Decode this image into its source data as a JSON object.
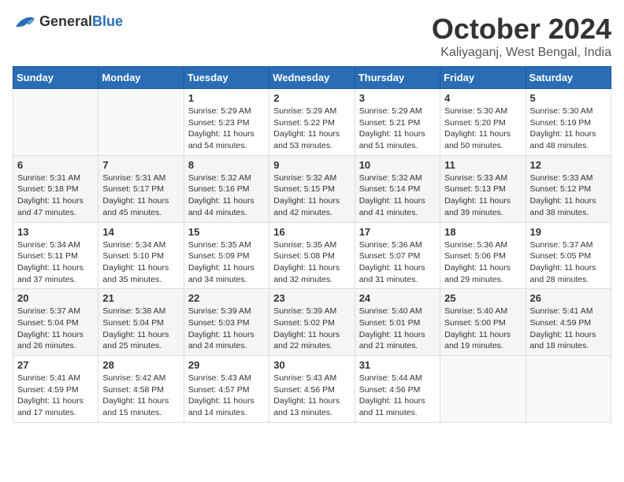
{
  "logo": {
    "general": "General",
    "blue": "Blue"
  },
  "title": "October 2024",
  "location": "Kaliyaganj, West Bengal, India",
  "weekdays": [
    "Sunday",
    "Monday",
    "Tuesday",
    "Wednesday",
    "Thursday",
    "Friday",
    "Saturday"
  ],
  "weeks": [
    [
      {
        "day": "",
        "text": ""
      },
      {
        "day": "",
        "text": ""
      },
      {
        "day": "1",
        "text": "Sunrise: 5:29 AM\nSunset: 5:23 PM\nDaylight: 11 hours and 54 minutes."
      },
      {
        "day": "2",
        "text": "Sunrise: 5:29 AM\nSunset: 5:22 PM\nDaylight: 11 hours and 53 minutes."
      },
      {
        "day": "3",
        "text": "Sunrise: 5:29 AM\nSunset: 5:21 PM\nDaylight: 11 hours and 51 minutes."
      },
      {
        "day": "4",
        "text": "Sunrise: 5:30 AM\nSunset: 5:20 PM\nDaylight: 11 hours and 50 minutes."
      },
      {
        "day": "5",
        "text": "Sunrise: 5:30 AM\nSunset: 5:19 PM\nDaylight: 11 hours and 48 minutes."
      }
    ],
    [
      {
        "day": "6",
        "text": "Sunrise: 5:31 AM\nSunset: 5:18 PM\nDaylight: 11 hours and 47 minutes."
      },
      {
        "day": "7",
        "text": "Sunrise: 5:31 AM\nSunset: 5:17 PM\nDaylight: 11 hours and 45 minutes."
      },
      {
        "day": "8",
        "text": "Sunrise: 5:32 AM\nSunset: 5:16 PM\nDaylight: 11 hours and 44 minutes."
      },
      {
        "day": "9",
        "text": "Sunrise: 5:32 AM\nSunset: 5:15 PM\nDaylight: 11 hours and 42 minutes."
      },
      {
        "day": "10",
        "text": "Sunrise: 5:32 AM\nSunset: 5:14 PM\nDaylight: 11 hours and 41 minutes."
      },
      {
        "day": "11",
        "text": "Sunrise: 5:33 AM\nSunset: 5:13 PM\nDaylight: 11 hours and 39 minutes."
      },
      {
        "day": "12",
        "text": "Sunrise: 5:33 AM\nSunset: 5:12 PM\nDaylight: 11 hours and 38 minutes."
      }
    ],
    [
      {
        "day": "13",
        "text": "Sunrise: 5:34 AM\nSunset: 5:11 PM\nDaylight: 11 hours and 37 minutes."
      },
      {
        "day": "14",
        "text": "Sunrise: 5:34 AM\nSunset: 5:10 PM\nDaylight: 11 hours and 35 minutes."
      },
      {
        "day": "15",
        "text": "Sunrise: 5:35 AM\nSunset: 5:09 PM\nDaylight: 11 hours and 34 minutes."
      },
      {
        "day": "16",
        "text": "Sunrise: 5:35 AM\nSunset: 5:08 PM\nDaylight: 11 hours and 32 minutes."
      },
      {
        "day": "17",
        "text": "Sunrise: 5:36 AM\nSunset: 5:07 PM\nDaylight: 11 hours and 31 minutes."
      },
      {
        "day": "18",
        "text": "Sunrise: 5:36 AM\nSunset: 5:06 PM\nDaylight: 11 hours and 29 minutes."
      },
      {
        "day": "19",
        "text": "Sunrise: 5:37 AM\nSunset: 5:05 PM\nDaylight: 11 hours and 28 minutes."
      }
    ],
    [
      {
        "day": "20",
        "text": "Sunrise: 5:37 AM\nSunset: 5:04 PM\nDaylight: 11 hours and 26 minutes."
      },
      {
        "day": "21",
        "text": "Sunrise: 5:38 AM\nSunset: 5:04 PM\nDaylight: 11 hours and 25 minutes."
      },
      {
        "day": "22",
        "text": "Sunrise: 5:39 AM\nSunset: 5:03 PM\nDaylight: 11 hours and 24 minutes."
      },
      {
        "day": "23",
        "text": "Sunrise: 5:39 AM\nSunset: 5:02 PM\nDaylight: 11 hours and 22 minutes."
      },
      {
        "day": "24",
        "text": "Sunrise: 5:40 AM\nSunset: 5:01 PM\nDaylight: 11 hours and 21 minutes."
      },
      {
        "day": "25",
        "text": "Sunrise: 5:40 AM\nSunset: 5:00 PM\nDaylight: 11 hours and 19 minutes."
      },
      {
        "day": "26",
        "text": "Sunrise: 5:41 AM\nSunset: 4:59 PM\nDaylight: 11 hours and 18 minutes."
      }
    ],
    [
      {
        "day": "27",
        "text": "Sunrise: 5:41 AM\nSunset: 4:59 PM\nDaylight: 11 hours and 17 minutes."
      },
      {
        "day": "28",
        "text": "Sunrise: 5:42 AM\nSunset: 4:58 PM\nDaylight: 11 hours and 15 minutes."
      },
      {
        "day": "29",
        "text": "Sunrise: 5:43 AM\nSunset: 4:57 PM\nDaylight: 11 hours and 14 minutes."
      },
      {
        "day": "30",
        "text": "Sunrise: 5:43 AM\nSunset: 4:56 PM\nDaylight: 11 hours and 13 minutes."
      },
      {
        "day": "31",
        "text": "Sunrise: 5:44 AM\nSunset: 4:56 PM\nDaylight: 11 hours and 11 minutes."
      },
      {
        "day": "",
        "text": ""
      },
      {
        "day": "",
        "text": ""
      }
    ]
  ]
}
